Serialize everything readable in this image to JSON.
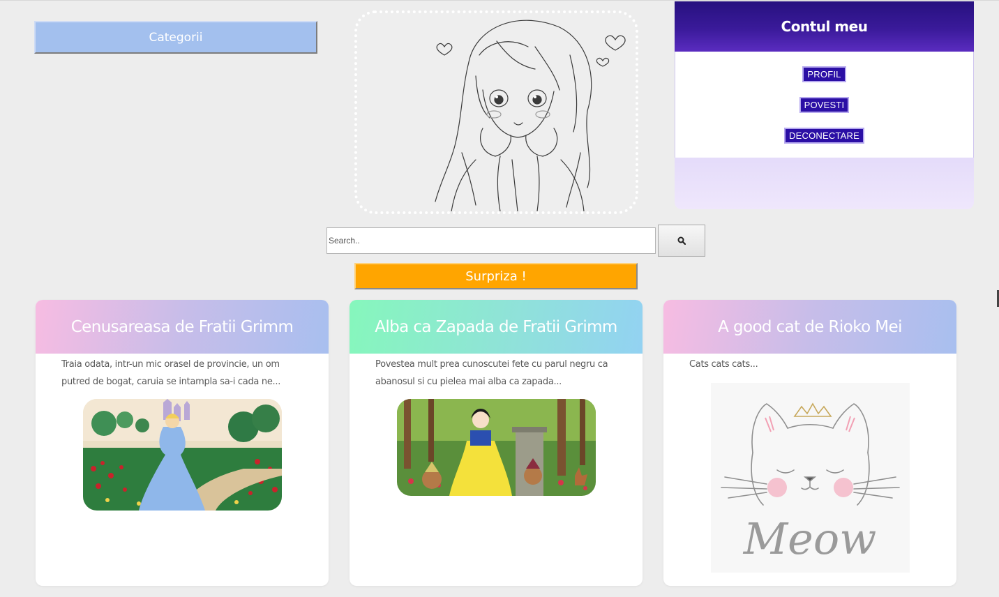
{
  "sidebar": {
    "categories_label": "Categorii"
  },
  "account": {
    "title": "Contul meu",
    "links": [
      "PROFIL",
      "POVESTI",
      "DECONECTARE"
    ]
  },
  "search": {
    "placeholder": "Search..",
    "button_icon": "search-icon"
  },
  "surprise": {
    "label": "Surpriza !"
  },
  "stories": [
    {
      "title": "Cenusareasa de Fratii Grimm",
      "excerpt": "Traia odata, intr-un mic orasel de provincie, un om putred de bogat, caruia se intampla sa-i cada ne...",
      "image": "cinderella-illustration",
      "header_colors": [
        "#f7bce2",
        "#a8bfef"
      ]
    },
    {
      "title": "Alba ca Zapada de Fratii Grimm",
      "excerpt": "Povestea mult prea cunoscutei fete cu parul negru ca abanosul si cu pielea mai alba ca zapada...",
      "image": "snow-white-illustration",
      "header_colors": [
        "#86f7bc",
        "#93d2f2"
      ]
    },
    {
      "title": "A good cat de Rioko Mei",
      "excerpt": "Cats cats cats...",
      "image": "meow-cat-illustration",
      "header_colors": [
        "#f7bce2",
        "#a8bfef"
      ]
    }
  ],
  "hero": {
    "image": "anime-girl-sketch",
    "image_text": "Meow"
  },
  "colors": {
    "accent_blue": "#a3c0ee",
    "account_purple": "#2b0fa5",
    "surprise_orange": "#ffa500",
    "page_bg": "#ededed"
  }
}
